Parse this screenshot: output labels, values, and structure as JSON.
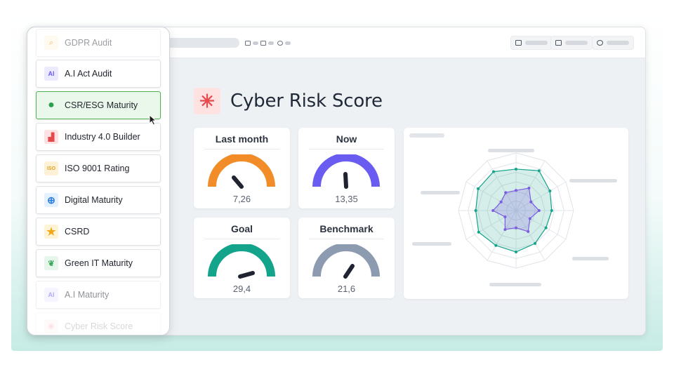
{
  "page": {
    "title": "Cyber Risk Score"
  },
  "colors": {
    "accent_green": "#4caf50",
    "gauge_last_month": "#f28c28",
    "gauge_now": "#6a5cf0",
    "gauge_goal": "#14a38b",
    "gauge_benchmark": "#8d9bb0",
    "radar_outer": "#14a38b",
    "radar_inner": "#7c5ce0"
  },
  "gauges": [
    {
      "label": "Last month",
      "value": "7,26",
      "numeric": 7.26
    },
    {
      "label": "Now",
      "value": "13,35",
      "numeric": 13.35
    },
    {
      "label": "Goal",
      "value": "29,4",
      "numeric": 29.4
    },
    {
      "label": "Benchmark",
      "value": "21,6",
      "numeric": 21.6
    }
  ],
  "sidebar": {
    "items": [
      {
        "label": "GDPR Audit",
        "icon": "search-icon"
      },
      {
        "label": "A.I Act Audit",
        "icon": "ai-chip-icon"
      },
      {
        "label": "CSR/ESG Maturity",
        "icon": "globe-icon"
      },
      {
        "label": "Industry 4.0 Builder",
        "icon": "factory-icon"
      },
      {
        "label": "ISO 9001 Rating",
        "icon": "iso-icon"
      },
      {
        "label": "Digital Maturity",
        "icon": "globe-icon"
      },
      {
        "label": "CSRD",
        "icon": "star-icon"
      },
      {
        "label": "Green IT Maturity",
        "icon": "leaf-icon"
      },
      {
        "label": "A.I Maturity",
        "icon": "ai-chip-icon"
      },
      {
        "label": "Cyber Risk Score",
        "icon": "asterisk-icon"
      }
    ]
  }
}
